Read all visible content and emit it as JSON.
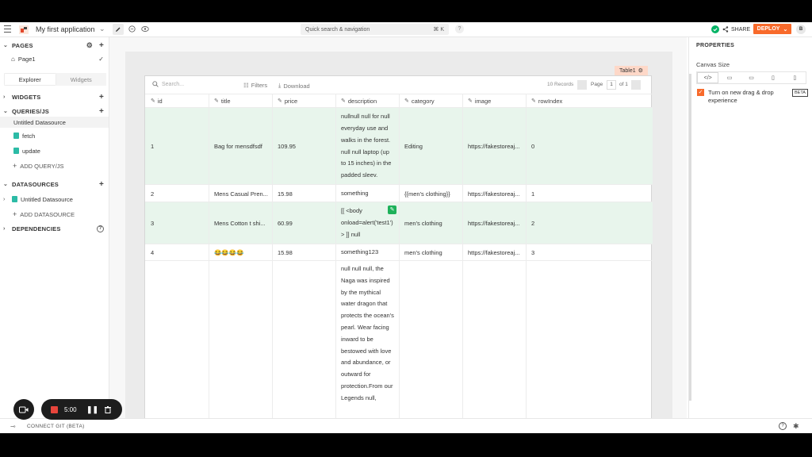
{
  "header": {
    "app_name": "My first application",
    "search_label": "Quick search & navigation",
    "search_shortcut": "⌘ K",
    "help": "?",
    "share": "SHARE",
    "deploy": "DEPLOY",
    "user_initial": "B"
  },
  "sidebar": {
    "pages_heading": "PAGES",
    "page1": "Page1",
    "tab_explorer": "Explorer",
    "tab_widgets": "Widgets",
    "widgets_heading": "WIDGETS",
    "queries_heading": "QUERIES/JS",
    "query_group": "Untitled Datasource",
    "query_fetch": "fetch",
    "query_update": "update",
    "add_query": "ADD QUERY/JS",
    "datasources_heading": "DATASOURCES",
    "datasource_1": "Untitled Datasource",
    "add_datasource": "ADD DATASOURCE",
    "dependencies_heading": "DEPENDENCIES"
  },
  "widget_label": "Table1",
  "table": {
    "search_placeholder": "Search...",
    "filters": "Filters",
    "download": "Download",
    "records": "10 Records",
    "page_label": "Page",
    "page_number": "1",
    "of_label": "of 1",
    "columns": [
      "id",
      "title",
      "price",
      "description",
      "category",
      "image",
      "rowIndex"
    ],
    "rows": [
      {
        "id": "1",
        "title": "Bag for mensdfsdf",
        "price": "109.95",
        "description": "nullnull null for null everyday use and walks in the forest. null null laptop (up to 15 inches) in the padded sleev.",
        "category": "Editing",
        "image": "https://fakestoreaj...",
        "rowIndex": "0",
        "highlight": true
      },
      {
        "id": "2",
        "title": "Mens Casual Pren...",
        "price": "15.98",
        "description": "something",
        "category": "{{men's clothing}}",
        "image": "https://fakestoreaj...",
        "rowIndex": "1",
        "highlight": false
      },
      {
        "id": "3",
        "title": "Mens Cotton t shi...",
        "price": "60.99",
        "description": "[[  <body onload=alert('test1') > ]] null",
        "category": "men's clothing",
        "image": "https://fakestoreaj...",
        "rowIndex": "2",
        "highlight": true
      },
      {
        "id": "4",
        "title": "😂😂😂😂",
        "price": "15.98",
        "description": "something123",
        "category": "men's clothing",
        "image": "https://fakestoreaj...",
        "rowIndex": "3",
        "highlight": false
      },
      {
        "id": "",
        "title": "",
        "price": "",
        "description": "null null null, the Naga was inspired by the mythical water dragon that protects the ocean's pearl. Wear facing inward to be bestowed with love and abundance, or outward for protection.From our Legends null,",
        "category": "",
        "image": "",
        "rowIndex": "",
        "highlight": false
      }
    ]
  },
  "properties": {
    "title": "PROPERTIES",
    "canvas_size": "Canvas Size",
    "size_options": [
      "</>",
      "▭",
      "▭",
      "▯",
      "▯"
    ],
    "drag_drop_label": "Turn on new drag & drop experience",
    "beta": "BETA"
  },
  "bottom": {
    "connect_git": "CONNECT GIT (BETA)"
  },
  "recorder": {
    "time": "5:00"
  },
  "colors": {
    "brand": "#f86a2b",
    "success": "#03b365",
    "row_highlight": "#e8f5ec"
  }
}
